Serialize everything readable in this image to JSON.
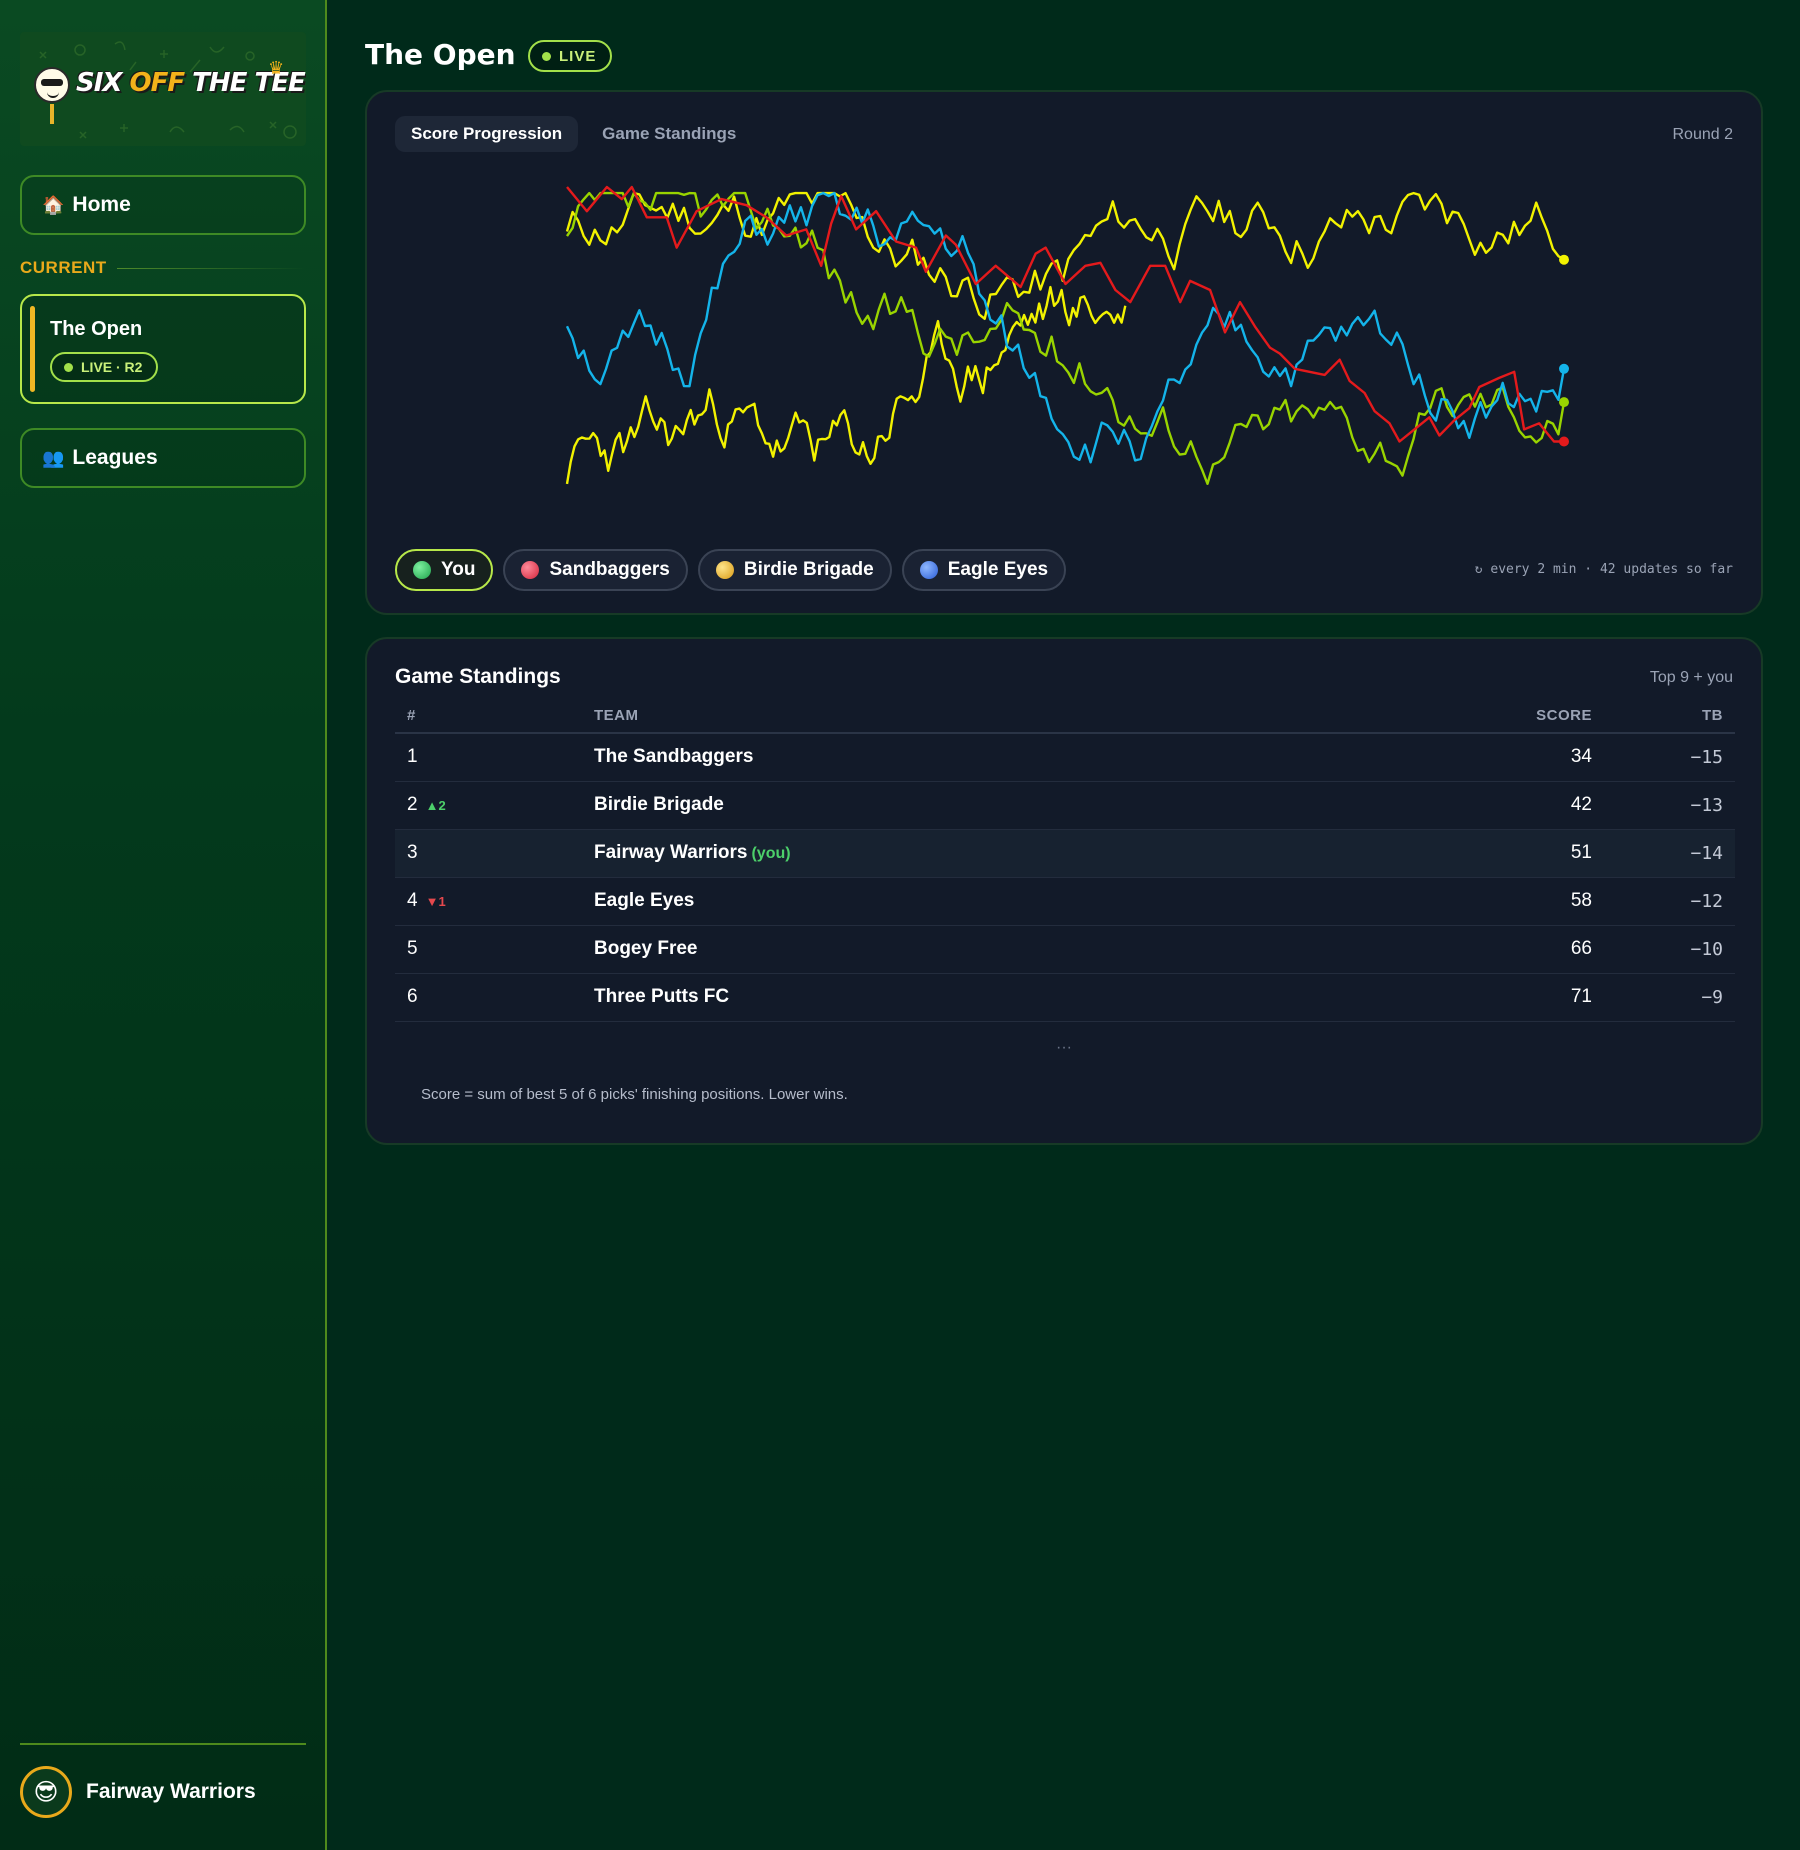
{
  "brand": {
    "name_part1": "SIX ",
    "name_part2": "OFF",
    "name_part3": " THE TEE"
  },
  "sidebar": {
    "home_label": "Home",
    "home_icon": "house-icon",
    "section_label": "CURRENT",
    "current": {
      "title": "The Open",
      "status": "LIVE · R2"
    },
    "leagues_label": "Leagues",
    "leagues_icon": "people-icon",
    "user": {
      "name": "Fairway Warriors",
      "avatar_icon": "golfer-avatar-icon"
    }
  },
  "header": {
    "title": "The Open",
    "status": "LIVE"
  },
  "chart_card": {
    "tabs": [
      {
        "label": "Score Progression",
        "active": true
      },
      {
        "label": "Game Standings",
        "active": false
      }
    ],
    "round_label": "Round 2",
    "legend": [
      {
        "label": "You",
        "color": "#a3e04a",
        "active": true
      },
      {
        "label": "Sandbaggers",
        "color": "#e5484d",
        "active": false
      },
      {
        "label": "Birdie Brigade",
        "color": "#f0c02a",
        "active": false
      },
      {
        "label": "Eagle Eyes",
        "color": "#3b82f6",
        "active": false
      }
    ],
    "updates_text": "↻ every 2 min · 42 updates so far"
  },
  "chart_data": {
    "type": "line",
    "title": "",
    "xlabel": "",
    "ylabel": "",
    "grid": false,
    "legend_position": "bottom-left",
    "ylim": [
      0,
      100
    ],
    "xlim": [
      0,
      1
    ],
    "series": [
      {
        "name": "Sandbaggers",
        "color": "#e41a1c",
        "points": [
          [
            0,
            100
          ],
          [
            0.02,
            92
          ],
          [
            0.04,
            100
          ],
          [
            0.055,
            96
          ],
          [
            0.065,
            100
          ],
          [
            0.08,
            90
          ],
          [
            0.1,
            90
          ],
          [
            0.11,
            80
          ],
          [
            0.13,
            92
          ],
          [
            0.155,
            96
          ],
          [
            0.18,
            94
          ],
          [
            0.2,
            90
          ],
          [
            0.22,
            84
          ],
          [
            0.24,
            86
          ],
          [
            0.255,
            74
          ],
          [
            0.265,
            88
          ],
          [
            0.275,
            97
          ],
          [
            0.29,
            86
          ],
          [
            0.3,
            89
          ],
          [
            0.31,
            92
          ],
          [
            0.33,
            82
          ],
          [
            0.35,
            80
          ],
          [
            0.36,
            72
          ],
          [
            0.38,
            84
          ],
          [
            0.39,
            81
          ],
          [
            0.41,
            68
          ],
          [
            0.43,
            74
          ],
          [
            0.455,
            67
          ],
          [
            0.47,
            78
          ],
          [
            0.48,
            80
          ],
          [
            0.5,
            68
          ],
          [
            0.52,
            74
          ],
          [
            0.535,
            75
          ],
          [
            0.55,
            66
          ],
          [
            0.565,
            62
          ],
          [
            0.585,
            74
          ],
          [
            0.6,
            74
          ],
          [
            0.615,
            62
          ],
          [
            0.625,
            69
          ],
          [
            0.645,
            66
          ],
          [
            0.66,
            52
          ],
          [
            0.675,
            62
          ],
          [
            0.69,
            54
          ],
          [
            0.705,
            47
          ],
          [
            0.715,
            45
          ],
          [
            0.73,
            40
          ],
          [
            0.76,
            38
          ],
          [
            0.775,
            43
          ],
          [
            0.785,
            36
          ],
          [
            0.8,
            32
          ],
          [
            0.81,
            26
          ],
          [
            0.825,
            22
          ],
          [
            0.835,
            16
          ],
          [
            0.85,
            20
          ],
          [
            0.865,
            24
          ],
          [
            0.875,
            18
          ],
          [
            0.89,
            23
          ],
          [
            0.905,
            27
          ],
          [
            0.915,
            34
          ],
          [
            0.935,
            37
          ],
          [
            0.95,
            39
          ],
          [
            0.96,
            20
          ],
          [
            0.975,
            22
          ],
          [
            0.985,
            18
          ],
          [
            1.0,
            16
          ],
          [
            1.0,
            16
          ],
          [
            0.99,
            16
          ]
        ]
      }
    ]
  },
  "standings": {
    "title": "Game Standings",
    "subtitle": "Top 9 + you",
    "columns": [
      "#",
      "TEAM",
      "SCORE",
      "TB"
    ],
    "rows": [
      {
        "rank": "1",
        "move": "",
        "move_dir": "",
        "team": "The Sandbaggers",
        "you": "",
        "score": "34",
        "tb": "−15"
      },
      {
        "rank": "2",
        "move": "▲2",
        "move_dir": "up",
        "team": "Birdie Brigade",
        "you": "",
        "score": "42",
        "tb": "−13"
      },
      {
        "rank": "3",
        "move": "",
        "move_dir": "",
        "team": "Fairway Warriors",
        "you": "(you)",
        "score": "51",
        "tb": "−14"
      },
      {
        "rank": "4",
        "move": "▼1",
        "move_dir": "down",
        "team": "Eagle Eyes",
        "you": "",
        "score": "58",
        "tb": "−12"
      },
      {
        "rank": "5",
        "move": "",
        "move_dir": "",
        "team": "Bogey Free",
        "you": "",
        "score": "66",
        "tb": "−10"
      },
      {
        "rank": "6",
        "move": "",
        "move_dir": "",
        "team": "Three Putts FC",
        "you": "",
        "score": "71",
        "tb": "−9"
      }
    ],
    "ellipsis": "···",
    "footnote": "Score = sum of best 5 of 6 picks' finishing positions. Lower wins."
  }
}
